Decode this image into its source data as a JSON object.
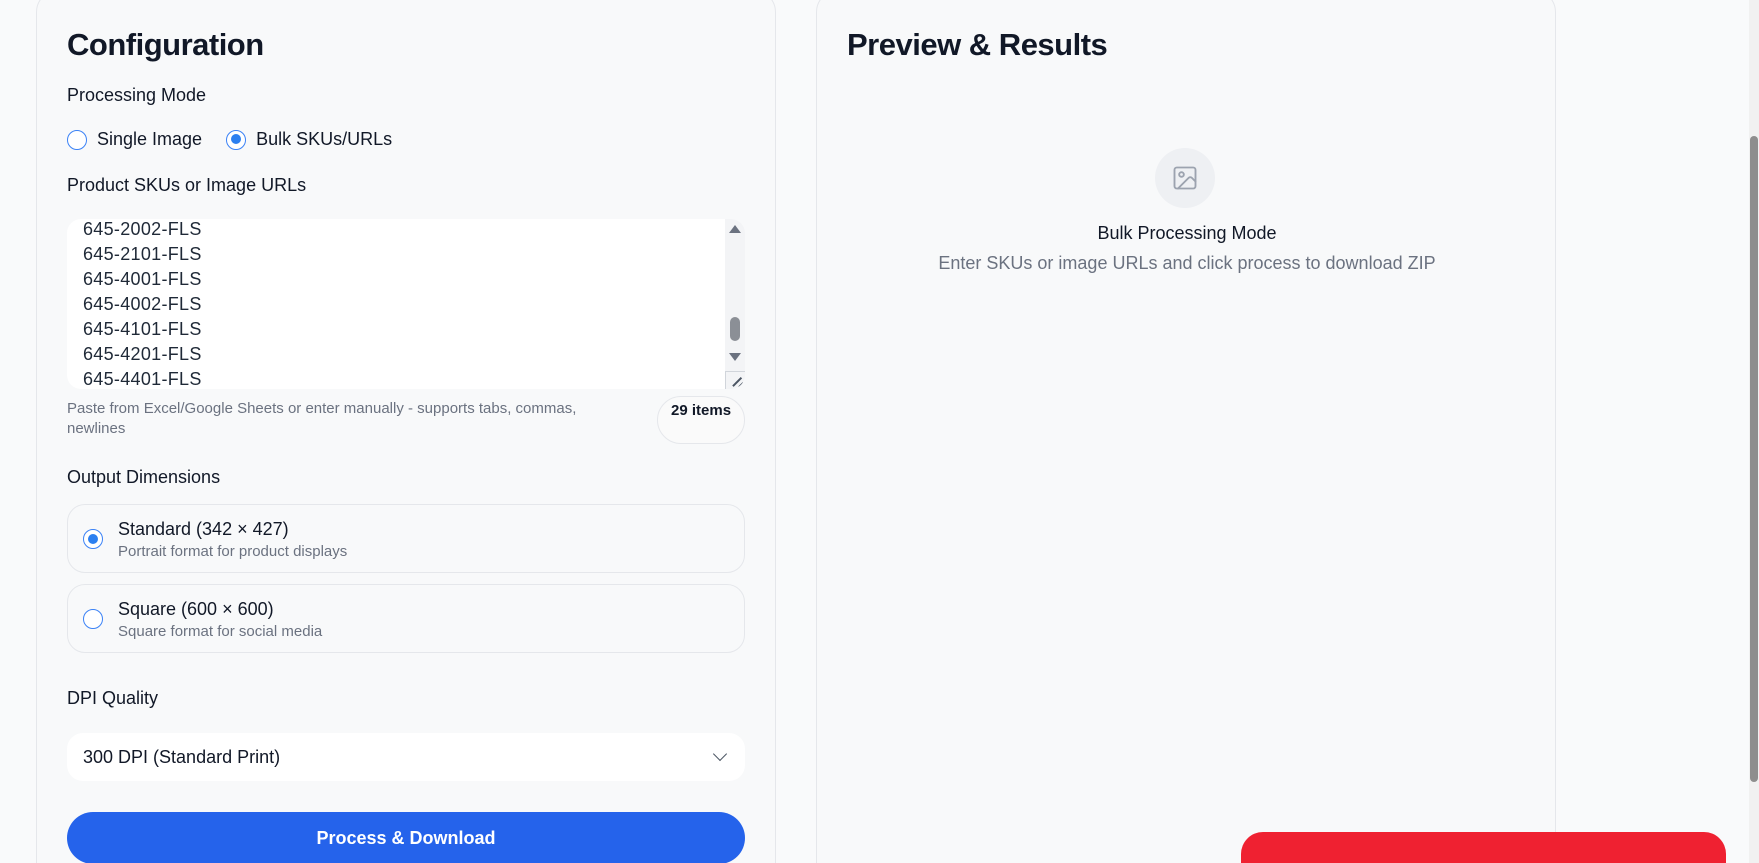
{
  "config": {
    "title": "Configuration",
    "processing_mode": {
      "label": "Processing Mode",
      "options": [
        {
          "label": "Single Image",
          "checked": false
        },
        {
          "label": "Bulk SKUs/URLs",
          "checked": true
        }
      ]
    },
    "skus": {
      "label": "Product SKUs or Image URLs",
      "visible_lines": [
        "645-2002-FLS",
        "645-2101-FLS",
        "645-4001-FLS",
        "645-4002-FLS",
        "645-4101-FLS",
        "645-4201-FLS",
        "645-4401-FLS"
      ],
      "hint": "Paste from Excel/Google Sheets or enter manually - supports tabs, commas, newlines",
      "count_label": "29 items"
    },
    "dimensions": {
      "label": "Output Dimensions",
      "options": [
        {
          "title": "Standard (342 × 427)",
          "subtitle": "Portrait format for product displays",
          "checked": true
        },
        {
          "title": "Square (600 × 600)",
          "subtitle": "Square format for social media",
          "checked": false
        }
      ]
    },
    "dpi": {
      "label": "DPI Quality",
      "selected": "300 DPI (Standard Print)"
    },
    "process_button": "Process & Download"
  },
  "preview": {
    "title": "Preview & Results",
    "empty_icon": "image-icon",
    "empty_title": "Bulk Processing Mode",
    "empty_subtitle": "Enter SKUs or image URLs and click process to download ZIP"
  },
  "colors": {
    "primary": "#2563eb",
    "radio_accent": "#2b7ff0",
    "alert_red": "#ef2131"
  }
}
